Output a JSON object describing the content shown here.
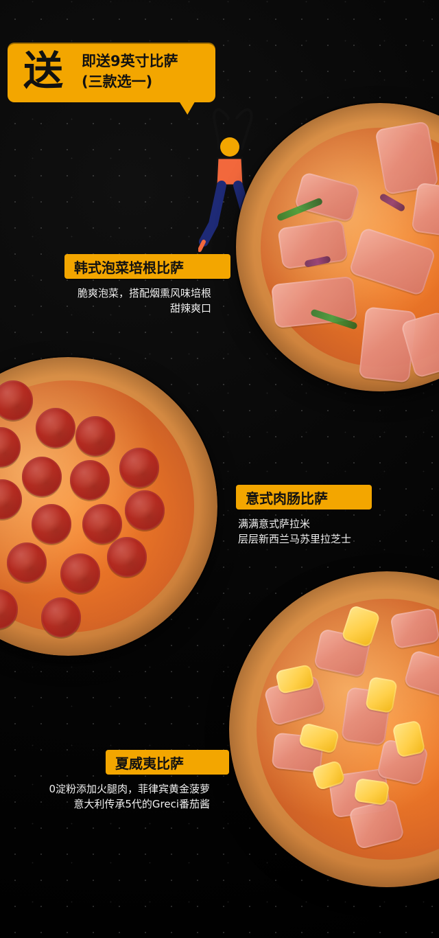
{
  "promo": {
    "big": "送",
    "line1": "即送9英寸比萨",
    "line2": "(三款选一)"
  },
  "items": [
    {
      "name": "韩式泡菜培根比萨",
      "desc_line1": "脆爽泡菜，搭配烟熏风味培根",
      "desc_line2": "甜辣爽口"
    },
    {
      "name": "意式肉肠比萨",
      "desc_line1": "满满意式萨拉米",
      "desc_line2": "层层新西兰马苏里拉芝士"
    },
    {
      "name": "夏威夷比萨",
      "desc_line1": "0淀粉添加火腿肉，菲律宾黄金菠萝",
      "desc_line2": "意大利传承5代的Greci番茄酱"
    }
  ],
  "colors": {
    "accent": "#f3a600",
    "background": "#050505"
  },
  "icons": {
    "dancer": "dancer-illustration",
    "pizza": "pizza-image"
  }
}
